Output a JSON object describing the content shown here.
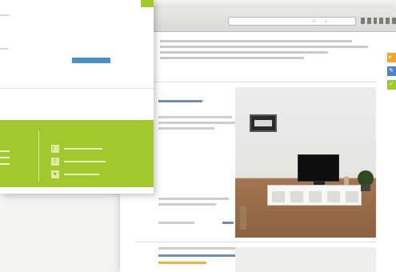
{
  "browser": {
    "url_text": "",
    "toolbar_icons": [
      "back-icon",
      "forward-icon",
      "reload-icon",
      "home-icon",
      "menu-icon",
      "settings-icon"
    ],
    "intro_lines": 4
  },
  "listing_controls": {
    "sort_labels": [
      "",
      "",
      ""
    ]
  },
  "listings": [
    {
      "stars": 0,
      "price_lines": [
        "",
        ""
      ],
      "footer_left": "",
      "footer_right": ""
    },
    {
      "header": "",
      "title": "",
      "rating": ""
    }
  ],
  "side_badges": [
    {
      "name": "orange-badge",
      "color": "#f5a52a",
      "glyph": "▸"
    },
    {
      "name": "blue-badge",
      "color": "#4a86c5",
      "glyph": "✎"
    },
    {
      "name": "green-badge",
      "color": "#9fcb2a",
      "glyph": "✓"
    }
  ],
  "front_window": {
    "corner_label": "",
    "small_button_label": "",
    "panel_items": [
      {
        "icon": "facebook-icon",
        "glyph": "f",
        "label": ""
      },
      {
        "icon": "share-icon",
        "glyph": "⇪",
        "label": ""
      },
      {
        "icon": "bookmark-icon",
        "glyph": "★",
        "label": ""
      }
    ]
  },
  "colors": {
    "accent_green": "#a2c92b",
    "link_blue": "#6d8fb5",
    "button_blue": "#4b90c8",
    "badge_orange": "#f5a52a"
  }
}
